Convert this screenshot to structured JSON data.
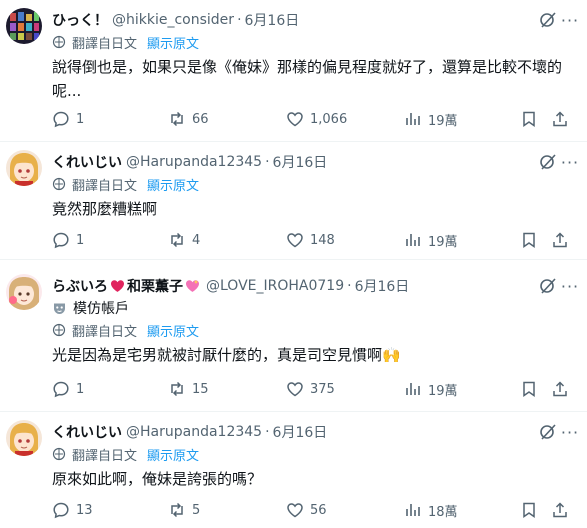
{
  "ui": {
    "translated_label": "翻譯自日文",
    "show_original_label": "顯示原文",
    "more_symbol": "···"
  },
  "tweets": [
    {
      "name": "ひっく！",
      "handle": "@hikkie_consider",
      "date": "6月16日",
      "text": "說得倒也是，如果只是像《俺妹》那樣的偏見程度就好了，還算是比較不壞的呢...",
      "replies": "1",
      "retweets": "66",
      "likes": "1,066",
      "views": "19萬"
    },
    {
      "name": "くれいじい",
      "handle": "@Harupanda12345",
      "date": "6月16日",
      "text": "竟然那麼糟糕啊",
      "replies": "1",
      "retweets": "4",
      "likes": "148",
      "views": "19萬"
    },
    {
      "name_part1": "らぶいろ",
      "name_part2": "和栗薫子",
      "handle": "@LOVE_IROHA0719",
      "date": "6月16日",
      "mimic_label": "模仿帳戶",
      "text": "光是因為是宅男就被討厭什麼的，真是司空見慣啊🙌",
      "replies": "1",
      "retweets": "15",
      "likes": "375",
      "views": "19萬"
    },
    {
      "name": "くれいじい",
      "handle": "@Harupanda12345",
      "date": "6月16日",
      "text": "原來如此啊，俺妹是誇張的嗎？",
      "replies": "13",
      "retweets": "5",
      "likes": "56",
      "views": "18萬"
    }
  ],
  "colors": {
    "text": "#0f1419",
    "secondary": "#536471",
    "link": "#1d9bf0",
    "divider": "#eff3f4"
  }
}
